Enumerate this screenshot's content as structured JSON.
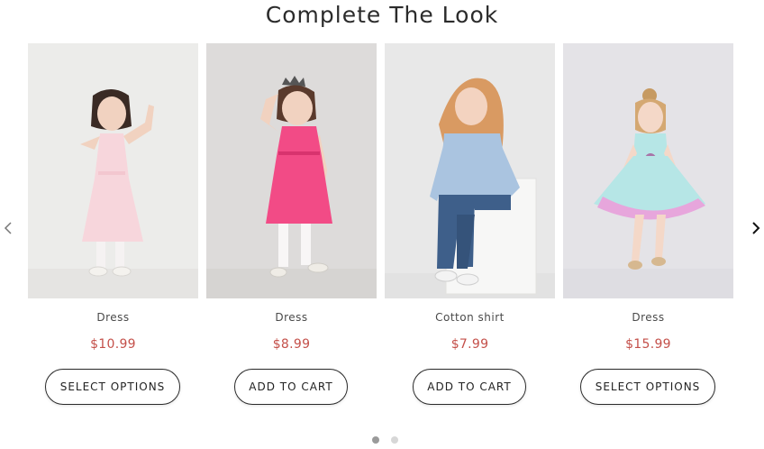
{
  "section": {
    "title": "Complete The Look",
    "prev_icon": "chevron-left-icon",
    "next_icon": "chevron-right-icon"
  },
  "products": [
    {
      "name": "Dress",
      "price": "$10.99",
      "button_label": "SELECT OPTIONS",
      "image": "girl-in-pale-pink-dress",
      "bg_color": "#ececea",
      "outfit_color": "#f7d6dc"
    },
    {
      "name": "Dress",
      "price": "$8.99",
      "button_label": "ADD TO CART",
      "image": "girl-in-hot-pink-dress-with-tiara",
      "bg_color": "#dddbda",
      "outfit_color": "#f24b86"
    },
    {
      "name": "Cotton shirt",
      "price": "$7.99",
      "button_label": "ADD TO CART",
      "image": "girl-in-denim-shirt-and-jeans",
      "bg_color": "#e8e8e8",
      "outfit_color": "#aac4e0"
    },
    {
      "name": "Dress",
      "price": "$15.99",
      "button_label": "SELECT OPTIONS",
      "image": "girl-in-mint-and-lilac-tulle-dress",
      "bg_color": "#e4e3e7",
      "outfit_color": "#b6e6e6"
    }
  ],
  "pagination": {
    "pages": 2,
    "active": 1
  },
  "colors": {
    "price": "#c4504a",
    "button_border": "#2a2a2a"
  }
}
